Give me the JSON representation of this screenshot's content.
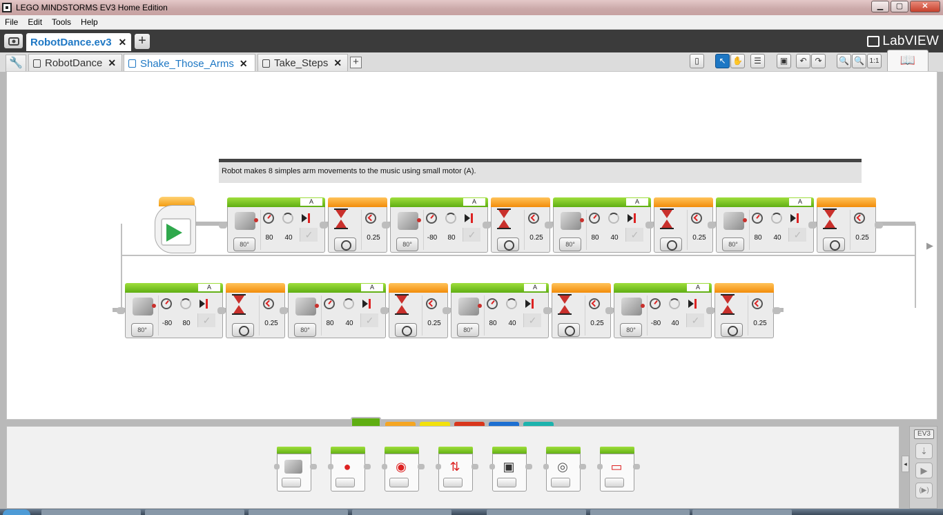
{
  "window": {
    "title": "LEGO MINDSTORMS EV3 Home Edition",
    "minimize": "▁",
    "maximize": "▢",
    "close": "✕"
  },
  "menu": [
    "File",
    "Edit",
    "Tools",
    "Help"
  ],
  "project": {
    "tab_label": "RobotDance.ev3",
    "close": "✕",
    "add": "+",
    "brand": "LabVIEW"
  },
  "program_tabs": [
    {
      "label": "RobotDance",
      "close": "✕",
      "active": false
    },
    {
      "label": "Shake_Those_Arms",
      "close": "✕",
      "active": true
    },
    {
      "label": "Take_Steps",
      "close": "✕",
      "active": false
    }
  ],
  "toolbar": {
    "zoom_reset": "1:1",
    "add_program": "+"
  },
  "comment": "Robot makes 8 simples arm movements to the music using small motor (A).",
  "blocks": {
    "row1": [
      {
        "kind": "motor",
        "port": "A",
        "speed": "80",
        "degrees": "40"
      },
      {
        "kind": "wait",
        "seconds": "0.25"
      },
      {
        "kind": "motor",
        "port": "A",
        "speed": "-80",
        "degrees": "80"
      },
      {
        "kind": "wait",
        "seconds": "0.25"
      },
      {
        "kind": "motor",
        "port": "A",
        "speed": "80",
        "degrees": "40"
      },
      {
        "kind": "wait",
        "seconds": "0.25"
      },
      {
        "kind": "motor",
        "port": "A",
        "speed": "80",
        "degrees": "40"
      },
      {
        "kind": "wait",
        "seconds": "0.25"
      }
    ],
    "row2": [
      {
        "kind": "motor",
        "port": "A",
        "speed": "-80",
        "degrees": "80"
      },
      {
        "kind": "wait",
        "seconds": "0.25"
      },
      {
        "kind": "motor",
        "port": "A",
        "speed": "80",
        "degrees": "40"
      },
      {
        "kind": "wait",
        "seconds": "0.25"
      },
      {
        "kind": "motor",
        "port": "A",
        "speed": "80",
        "degrees": "40"
      },
      {
        "kind": "wait",
        "seconds": "0.25"
      },
      {
        "kind": "motor",
        "port": "A",
        "speed": "-80",
        "degrees": "40"
      },
      {
        "kind": "wait",
        "seconds": "0.25"
      }
    ],
    "mode_label": "80°"
  },
  "palette": {
    "tab_colors": [
      "#5fae12",
      "#f5a623",
      "#f2e10c",
      "#d9361c",
      "#1d6fd1",
      "#1db3ad"
    ],
    "action_blocks": [
      "medium-motor-icon",
      "large-motor-icon",
      "move-steering-icon",
      "move-tank-icon",
      "display-icon",
      "sound-icon",
      "brick-status-light-icon"
    ]
  },
  "hardware": {
    "label": "EV3",
    "download": "⇣",
    "run": "▶",
    "run_selected": "(▶)",
    "collapse": "◂"
  },
  "canvas_arrow": "▶"
}
